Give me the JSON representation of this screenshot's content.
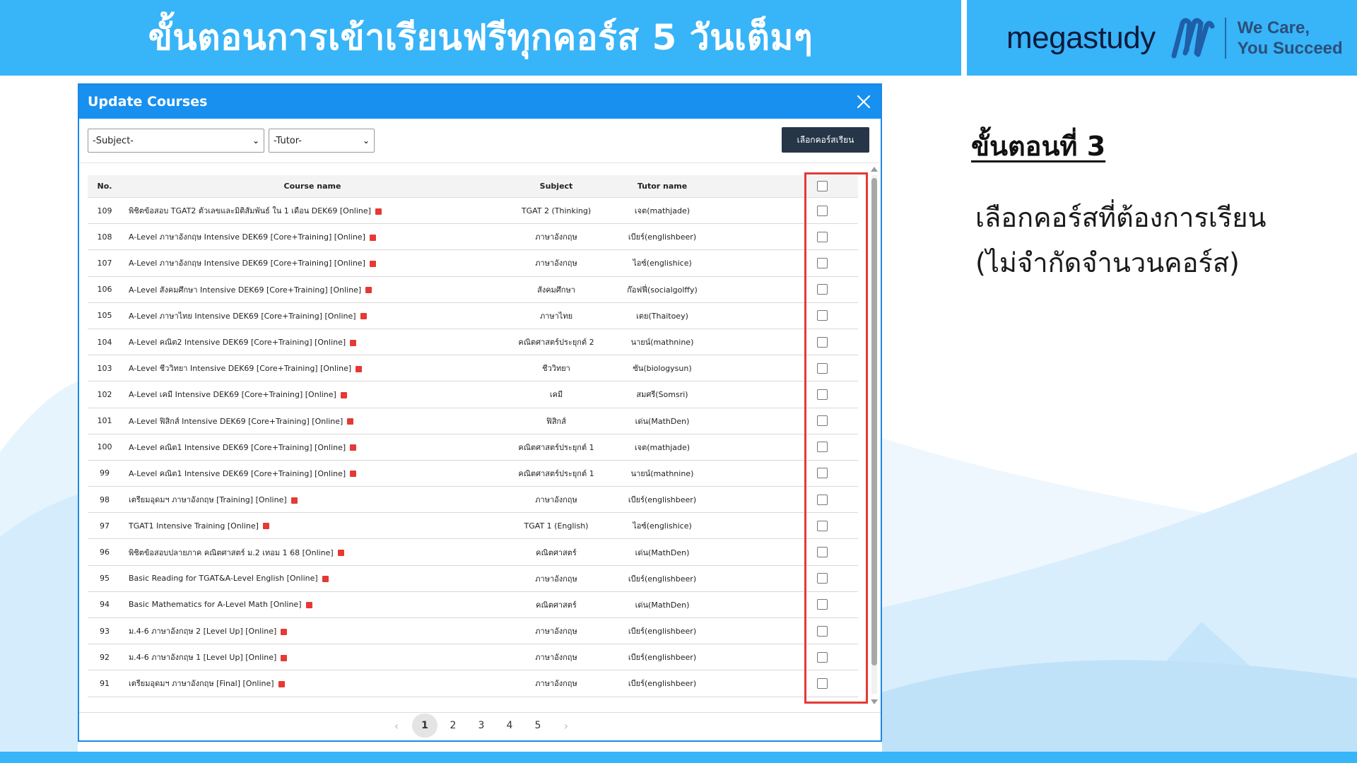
{
  "banner": {
    "title": "ขั้นตอนการเข้าเรียนฟรีทุกคอร์ส 5 วันเต็มๆ",
    "brand": "megastudy",
    "tagline_1": "We Care,",
    "tagline_2": "You Succeed"
  },
  "instructions": {
    "step_title": "ขั้นตอนที่ 3",
    "line_1": "เลือกคอร์สที่ต้องการเรียน",
    "line_2": "(ไม่จำกัดจำนวนคอร์ส)"
  },
  "modal": {
    "title": "Update Courses",
    "subject_select": "-Subject-",
    "tutor_select": "-Tutor-",
    "select_button": "เลือกคอร์สเรียน",
    "headers": {
      "no": "No.",
      "course": "Course name",
      "subject": "Subject",
      "tutor": "Tutor name"
    },
    "rows": [
      {
        "no": "109",
        "course": "พิชิตข้อสอบ TGAT2 ตัวเลขและมิติสัมพันธ์ ใน 1 เดือน DEK69 [Online]",
        "subject": "TGAT 2 (Thinking)",
        "tutor": "เจต(mathjade)"
      },
      {
        "no": "108",
        "course": "A-Level ภาษาอังกฤษ Intensive DEK69 [Core+Training] [Online]",
        "subject": "ภาษาอังกฤษ",
        "tutor": "เบียร์(englishbeer)"
      },
      {
        "no": "107",
        "course": "A-Level ภาษาอังกฤษ Intensive DEK69 [Core+Training] [Online]",
        "subject": "ภาษาอังกฤษ",
        "tutor": "ไอซ์(englishice)"
      },
      {
        "no": "106",
        "course": "A-Level สังคมศึกษา Intensive DEK69 [Core+Training] [Online]",
        "subject": "สังคมศึกษา",
        "tutor": "ก๊อฟฟี่(socialgolffy)"
      },
      {
        "no": "105",
        "course": "A-Level ภาษาไทย Intensive DEK69 [Core+Training] [Online]",
        "subject": "ภาษาไทย",
        "tutor": "เตย(Thaitoey)"
      },
      {
        "no": "104",
        "course": "A-Level คณิต2 Intensive DEK69 [Core+Training] [Online]",
        "subject": "คณิตศาสตร์ประยุกต์ 2",
        "tutor": "นายน์(mathnine)"
      },
      {
        "no": "103",
        "course": "A-Level ชีววิทยา Intensive DEK69 [Core+Training] [Online]",
        "subject": "ชีววิทยา",
        "tutor": "ซัน(biologysun)"
      },
      {
        "no": "102",
        "course": "A-Level เคมี Intensive DEK69 [Core+Training] [Online]",
        "subject": "เคมี",
        "tutor": "สมศรี(Somsri)"
      },
      {
        "no": "101",
        "course": "A-Level ฟิสิกส์ Intensive DEK69 [Core+Training] [Online]",
        "subject": "ฟิสิกส์",
        "tutor": "เด่น(MathDen)"
      },
      {
        "no": "100",
        "course": "A-Level คณิต1 Intensive DEK69 [Core+Training] [Online]",
        "subject": "คณิตศาสตร์ประยุกต์ 1",
        "tutor": "เจต(mathjade)"
      },
      {
        "no": "99",
        "course": "A-Level คณิต1 Intensive DEK69 [Core+Training] [Online]",
        "subject": "คณิตศาสตร์ประยุกต์ 1",
        "tutor": "นายน์(mathnine)"
      },
      {
        "no": "98",
        "course": "เตรียมอุดมฯ ภาษาอังกฤษ [Training] [Online]",
        "subject": "ภาษาอังกฤษ",
        "tutor": "เบียร์(englishbeer)"
      },
      {
        "no": "97",
        "course": "TGAT1 Intensive Training [Online]",
        "subject": "TGAT 1 (English)",
        "tutor": "ไอซ์(englishice)"
      },
      {
        "no": "96",
        "course": "พิชิตข้อสอบปลายภาค คณิตศาสตร์ ม.2 เทอม 1 68 [Online]",
        "subject": "คณิตศาสตร์",
        "tutor": "เด่น(MathDen)"
      },
      {
        "no": "95",
        "course": "Basic Reading for TGAT&A-Level English [Online]",
        "subject": "ภาษาอังกฤษ",
        "tutor": "เบียร์(englishbeer)"
      },
      {
        "no": "94",
        "course": "Basic Mathematics for A-Level Math [Online]",
        "subject": "คณิตศาสตร์",
        "tutor": "เด่น(MathDen)"
      },
      {
        "no": "93",
        "course": "ม.4-6 ภาษาอังกฤษ 2 [Level Up] [Online]",
        "subject": "ภาษาอังกฤษ",
        "tutor": "เบียร์(englishbeer)"
      },
      {
        "no": "92",
        "course": "ม.4-6 ภาษาอังกฤษ 1 [Level Up] [Online]",
        "subject": "ภาษาอังกฤษ",
        "tutor": "เบียร์(englishbeer)"
      },
      {
        "no": "91",
        "course": "เตรียมอุดมฯ ภาษาอังกฤษ [Final] [Online]",
        "subject": "ภาษาอังกฤษ",
        "tutor": "เบียร์(englishbeer)"
      }
    ],
    "pages": [
      "1",
      "2",
      "3",
      "4",
      "5"
    ],
    "current_page": "1",
    "prev_label": "‹",
    "next_label": "›"
  },
  "colors": {
    "banner": "#38b4f8",
    "modal_header": "#1790f0",
    "highlight": "#e53935",
    "button": "#263547"
  }
}
